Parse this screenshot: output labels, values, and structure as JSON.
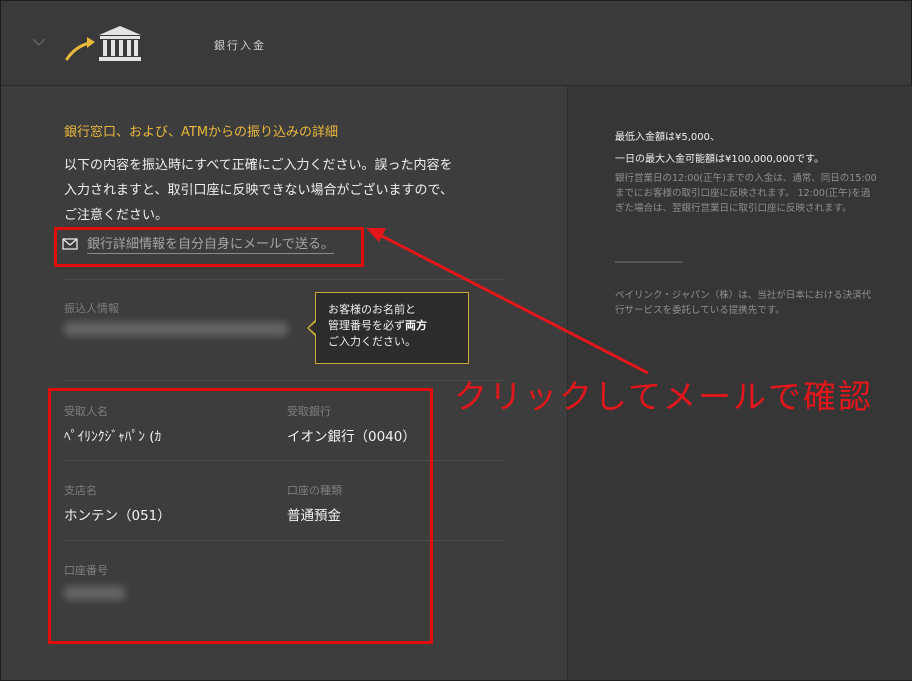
{
  "header": {
    "title": "銀行入金"
  },
  "section": {
    "title": "銀行窓口、および、ATMからの振り込みの詳細",
    "intro_line1": "以下の内容を振込時にすべて正確にご入力ください。誤った内容を",
    "intro_line2": "入力されますと、取引口座に反映できない場合がございますので、",
    "intro_line3": "ご注意ください。"
  },
  "email_link": {
    "label": "銀行詳細情報を自分自身にメールで送る。"
  },
  "depositor": {
    "label": "振込人情報"
  },
  "tooltip": {
    "line1": "お客様のお名前と",
    "line2_prefix": "管理番号を必ず",
    "line2_bold": "両方",
    "line3": "ご入力ください。"
  },
  "fields": {
    "recipient_name": {
      "label": "受取人名",
      "value": "ﾍﾟｲﾘﾝｸｼﾞｬﾊﾟﾝ (ｶ"
    },
    "recipient_bank": {
      "label": "受取銀行",
      "value": "イオン銀行（0040）"
    },
    "branch_name": {
      "label": "支店名",
      "value": "ホンテン（051）"
    },
    "account_type": {
      "label": "口座の種類",
      "value": "普通預金"
    },
    "account_number": {
      "label": "口座番号"
    }
  },
  "right_panel": {
    "min_deposit": "最低入金額は¥5,000、",
    "max_deposit": "一日の最大入金可能額は¥100,000,000です。",
    "note1": "銀行営業日の12:00(正午)までの入金は、通常、同日の15:00までにお客様の取引口座に反映されます。 12:00(正午)を過ぎた場合は、翌銀行営業日に取引口座に反映されます。",
    "note2": "ペイリンク・ジャパン（株）は、当社が日本における決済代行サービスを委託している提携先です。"
  },
  "annotation": {
    "text": "クリックしてメールで確認"
  },
  "colors": {
    "accent": "#e9b73c",
    "annotation_red": "#e3161b",
    "background": "#3d3d3d"
  },
  "icons": [
    "chevron-down-icon",
    "bank-deposit-icon",
    "mail-icon"
  ]
}
